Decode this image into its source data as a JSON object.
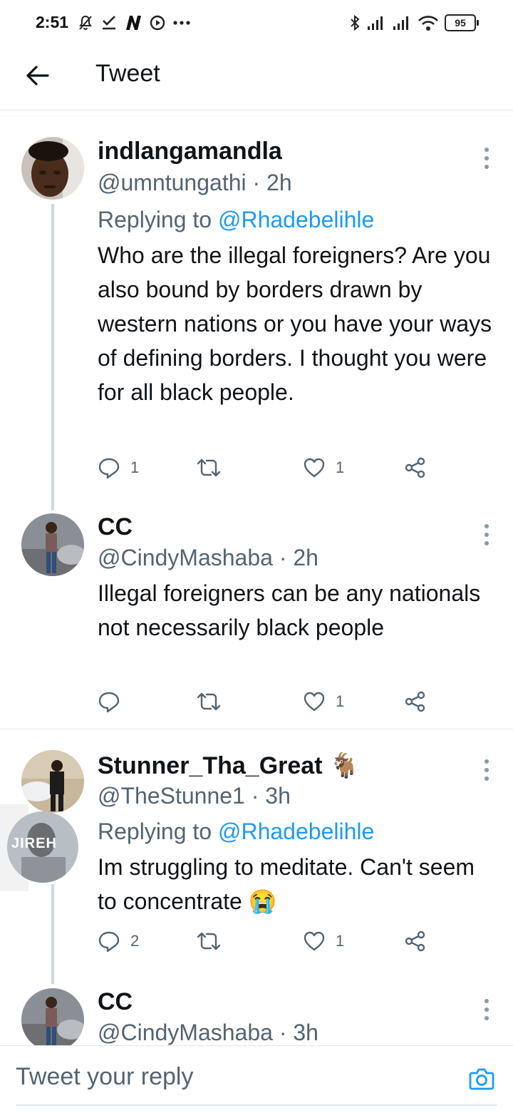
{
  "status_bar": {
    "time": "2:51",
    "more": "…",
    "battery": "95",
    "icons_left": [
      "muted-notifications-icon",
      "download-done-icon",
      "n-app-icon",
      "record-icon",
      "more-dots-icon"
    ],
    "icons_right": [
      "bluetooth-icon",
      "signal-icon",
      "signal-icon",
      "wifi-icon",
      "battery-icon"
    ]
  },
  "app_bar": {
    "title": "Tweet"
  },
  "tweets": [
    {
      "name": "indlangamandla",
      "handle": "@umntungathi · 2h",
      "reply_prefix": "Replying to ",
      "reply_to": "@Rhadebelihle",
      "text": "Who are the illegal foreigners? Are you also bound by borders drawn by western nations or you have your ways of defining borders. I thought you were for all black people.",
      "replies": "1",
      "retweets": "",
      "likes": "1"
    },
    {
      "name": "CC",
      "handle": "@CindyMashaba · 2h",
      "text": "Illegal foreigners can be any nationals  not necessarily black people",
      "replies": "",
      "retweets": "",
      "likes": "1"
    },
    {
      "name": "Stunner_Tha_Great",
      "name_emoji": "🐐",
      "handle": "@TheStunne1 · 3h",
      "reply_prefix": "Replying to ",
      "reply_to": "@Rhadebelihle",
      "text": "Im struggling to meditate. Can't seem to concentrate 😭",
      "replies": "2",
      "retweets": "",
      "likes": "1",
      "overlay_avatar_text": "JIREH"
    },
    {
      "name": "CC",
      "handle": "@CindyMashaba · 3h"
    }
  ],
  "reply_bar": {
    "placeholder": "Tweet your reply"
  },
  "colors": {
    "accent": "#1d9bf0",
    "secondary_text": "#536471",
    "thread_line": "#cfd9de"
  }
}
